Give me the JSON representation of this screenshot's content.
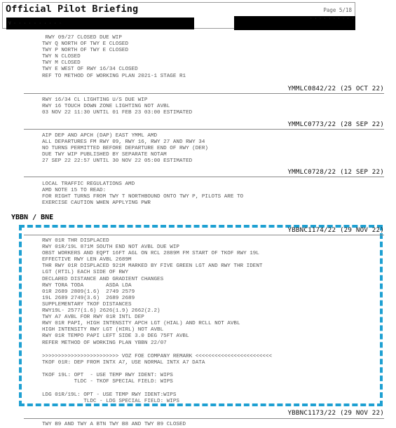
{
  "header": {
    "title": "Official Pilot Briefing",
    "page": "Page 5/18",
    "redacted_left": "V · · · · · · · · · ·",
    "redacted_right": "· · · · · · · · · ·"
  },
  "notams_top": [
    {
      "text": " RWY 09/27 CLOSED DUE WIP\nTWY Q NORTH OF TWY E CLOSED\nTWY P NORTH OF TWY E CLOSED\nTWY N CLOSED\nTWY M CLOSED\nTWY E WEST OF RWY 16/34 CLOSED\nREF TO METHOD OF WORKING PLAN 2021-1 STAGE R1",
      "ref": "YMMLC0842/22 (25 OCT 22)"
    },
    {
      "text": "RWY 16/34 CL LIGHTING U/S DUE WIP\nRWY 16 TOUCH DOWN ZONE LIGHTING NOT AVBL\n03 NOV 22 11:30 UNTIL 01 FEB 23 03:00 ESTIMATED",
      "ref": "YMMLC0773/22 (28 SEP 22)"
    },
    {
      "text": "AIP DEP AND APCH (DAP) EAST YMML AMD\nALL DEPARTURES FM RWY 09, RWY 16, RWY 27 AND RWY 34\nNO TURNS PERMITTED BEFORE DEPARTURE END OF RWY (DER)\nDUE TWY WIP PUBLISHED BY SEPARATE NOTAM\n27 SEP 22 22:57 UNTIL 30 NOV 22 05:00 ESTIMATED",
      "ref": "YMMLC0728/22 (12 SEP 22)"
    },
    {
      "text": "LOCAL TRAFFIC REGULATIONS AMD\nAMD NOTE 15 TO READ:\nFOR RIGHT TURNS FROM TWY T NORTHBOUND ONTO TWY P, PILOTS ARE TO\nEXERCISE CAUTION WHEN APPLYING PWR"
    }
  ],
  "section": {
    "title": "YBBN / BNE",
    "highlight_color": "#1ea0d2",
    "notams": [
      {
        "ref": "YBBNC1174/22 (29 NOV 22)",
        "text": "RWY 01R THR DISPLACED\nRWY 01R/19L 871M SOUTH END NOT AVBL DUE WIP\nOBST WORKERS AND EQPT 16FT AGL ON RCL 2889M FM START OF TKOF RWY 19L\nEFFECTIVE RWY LEN AVBL 2689M\nTHR RWY 01R DISPLACED 921M MARKED BY FIVE GREEN LGT AND RWY THR IDENT\nLGT (RTIL) EACH SIDE OF RWY\nDECLARED DISTANCE AND GRADIENT CHANGES\nRWY TORA TODA       ASDA LDA\n01R 2689 2809(1.6)  2749 2579\n19L 2689 2749(3.6)  2689 2689\nSUPPLEMENTARY TKOF DISTANCES\nRWY19L- 2577(1.6) 2626(1.9) 2662(2.2)\nTWY A7 AVBL FOR RWY 01R INTL DEP\nRWY 01R PAPI, HIGH INTENSITY APCH LGT (HIAL) AND RCLL NOT AVBL\nHIGH INTENSITY RWY LGT (HIRL) NOT AVBL\nRWY 01R TEMPO PAPI LEFT SIDE 3.0 DEG 75FT AVBL\nREFER METHOD OF WORKING PLAN YBBN 22/07",
        "remark": ">>>>>>>>>>>>>>>>>>>>>>>> VOZ FOE COMPANY REMARK <<<<<<<<<<<<<<<<<<<<<<<<\nTKOF 01R: DEP FROM INTX A7, USE NORMAL INTX A7 DATA\n\nTKOF 19L: OPT  - USE TEMP RWY IDENT: WIPS\n          TLDC - TKOF SPECIAL FIELD: WIPS\n\nLDG 01R/19L: OPT - USE TEMP RWY IDENT:WIPS\n             TLDC - LDG SPECIAL FIELD: WIPS"
      },
      {
        "ref": "YBBNC1173/22 (29 NOV 22)",
        "text": "TWY B9 AND TWY A BTN TWY B8 AND TWY B9 CLOSED"
      }
    ]
  }
}
